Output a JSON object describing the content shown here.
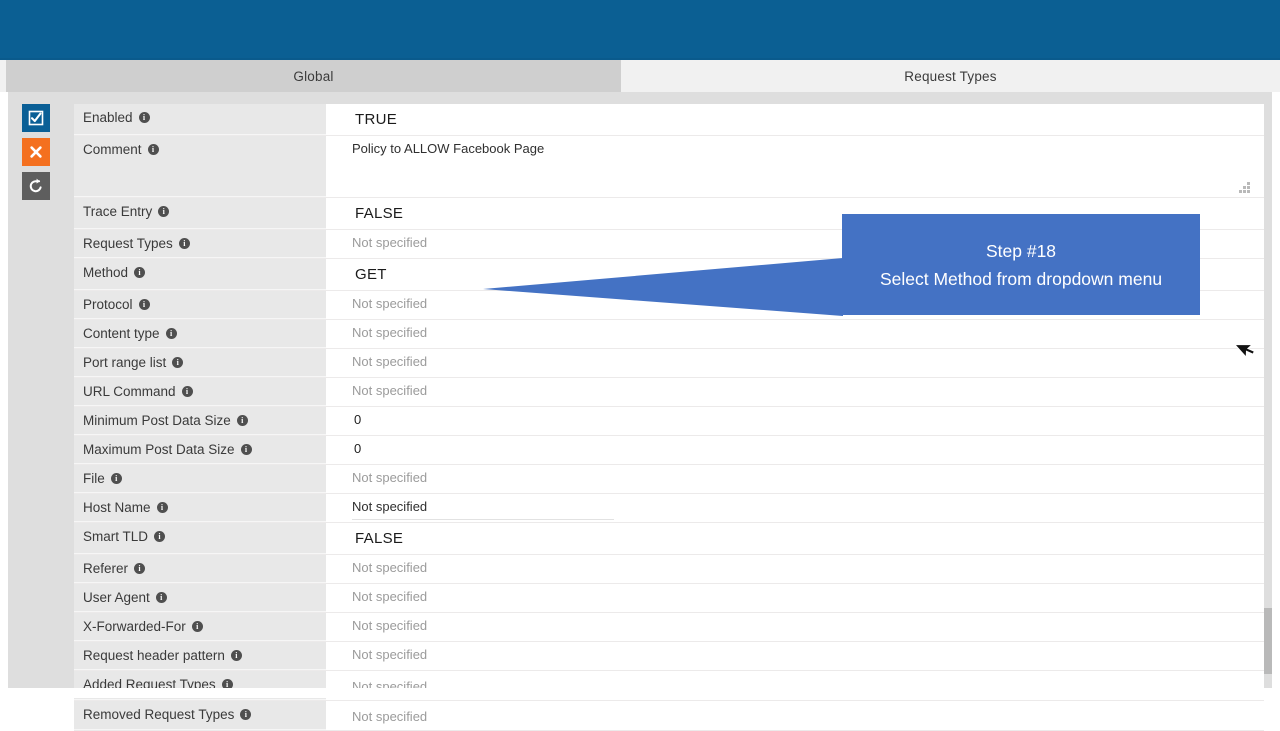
{
  "theme": {
    "banner_blue": "#0b5f93",
    "callout_blue": "#4472c4",
    "apply_blue": "#0a5f96",
    "cancel_orange": "#f4701f",
    "revert_gray": "#5e5e5e",
    "label_bg": "#e8e8e8",
    "active_tab_bg": "#cfcfcf",
    "panel_bg": "#dedede"
  },
  "tabs": [
    {
      "id": "global",
      "label": "Global",
      "active": true
    },
    {
      "id": "request-types",
      "label": "Request Types",
      "active": false
    }
  ],
  "toolbar": {
    "apply_label": "Apply",
    "cancel_label": "Cancel",
    "revert_label": "Revert",
    "icons": [
      "checkbox-check-icon",
      "close-x-icon",
      "undo-revert-icon"
    ]
  },
  "info_icon_glyph": "i",
  "placeholders": {
    "not_specified": "Not specified"
  },
  "fields": [
    {
      "name": "enabled",
      "label": "Enabled",
      "value": "TRUE",
      "kind": "select"
    },
    {
      "name": "comment",
      "label": "Comment",
      "value": "Policy to ALLOW Facebook Page",
      "kind": "textarea"
    },
    {
      "name": "trace-entry",
      "label": "Trace Entry",
      "value": "FALSE",
      "kind": "select"
    },
    {
      "name": "request-types",
      "label": "Request Types",
      "value": "Not specified",
      "kind": "empty"
    },
    {
      "name": "method",
      "label": "Method",
      "value": "GET",
      "kind": "select"
    },
    {
      "name": "protocol",
      "label": "Protocol",
      "value": "Not specified",
      "kind": "empty"
    },
    {
      "name": "content-type",
      "label": "Content type",
      "value": "Not specified",
      "kind": "empty"
    },
    {
      "name": "port-range-list",
      "label": "Port range list",
      "value": "Not specified",
      "kind": "empty"
    },
    {
      "name": "url-command",
      "label": "URL Command",
      "value": "Not specified",
      "kind": "empty"
    },
    {
      "name": "minimum-post-data-size",
      "label": "Minimum Post Data Size",
      "value": "0",
      "kind": "number"
    },
    {
      "name": "maximum-post-data-size",
      "label": "Maximum Post Data Size",
      "value": "0",
      "kind": "number"
    },
    {
      "name": "file",
      "label": "File",
      "value": "Not specified",
      "kind": "empty"
    },
    {
      "name": "host-name",
      "label": "Host Name",
      "value": "Not specified",
      "kind": "input"
    },
    {
      "name": "smart-tld",
      "label": "Smart TLD",
      "value": "FALSE",
      "kind": "select"
    },
    {
      "name": "referer",
      "label": "Referer",
      "value": "Not specified",
      "kind": "empty"
    },
    {
      "name": "user-agent",
      "label": "User Agent",
      "value": "Not specified",
      "kind": "empty"
    },
    {
      "name": "x-forwarded-for",
      "label": "X-Forwarded-For",
      "value": "Not specified",
      "kind": "empty"
    },
    {
      "name": "request-header-pattern",
      "label": "Request header pattern",
      "value": "Not specified",
      "kind": "empty"
    },
    {
      "name": "added-request-types",
      "label": "Added Request Types",
      "value": "Not specified",
      "kind": "empty-tall"
    },
    {
      "name": "removed-request-types",
      "label": "Removed Request Types",
      "value": "Not specified",
      "kind": "empty-tall"
    }
  ],
  "callout": {
    "line1": "Step #18",
    "line2": "Select Method from dropdown menu",
    "text": "Step #18\nSelect Method from dropdown menu"
  },
  "cursor": {
    "name": "mouse-pointer-cursor"
  }
}
